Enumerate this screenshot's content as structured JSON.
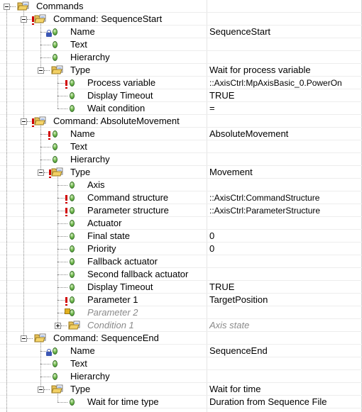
{
  "window": {
    "title": "Commands"
  },
  "rows": [
    {
      "label": "Commands",
      "value": "",
      "level": 0,
      "kind": "folder",
      "expander": "open",
      "icon": "commands-folder-icon"
    },
    {
      "label": "Command: SequenceStart",
      "value": "",
      "level": 1,
      "kind": "folder",
      "expander": "open",
      "error": true,
      "icon": "command-folder-icon"
    },
    {
      "label": "Name",
      "value": "SequenceStart",
      "level": 2,
      "kind": "leaf",
      "lock": true,
      "icon": "property-icon"
    },
    {
      "label": "Text",
      "value": "",
      "level": 2,
      "kind": "leaf",
      "icon": "property-icon"
    },
    {
      "label": "Hierarchy",
      "value": "",
      "level": 2,
      "kind": "leaf",
      "icon": "property-icon"
    },
    {
      "label": "Type",
      "value": "Wait for process variable",
      "level": 2,
      "kind": "folder",
      "expander": "open",
      "icon": "type-folder-icon"
    },
    {
      "label": "Process variable",
      "value": "::AxisCtrl:MpAxisBasic_0.PowerOn",
      "level": 3,
      "kind": "leaf",
      "error": true,
      "small": true,
      "icon": "property-icon"
    },
    {
      "label": "Display Timeout",
      "value": "TRUE",
      "level": 3,
      "kind": "leaf",
      "icon": "property-icon"
    },
    {
      "label": "Wait condition",
      "value": "=",
      "level": 3,
      "kind": "leaf",
      "icon": "property-icon"
    },
    {
      "label": "Command: AbsoluteMovement",
      "value": "",
      "level": 1,
      "kind": "folder",
      "expander": "open",
      "error": true,
      "icon": "command-folder-icon"
    },
    {
      "label": "Name",
      "value": "AbsoluteMovement",
      "level": 2,
      "kind": "leaf",
      "error": true,
      "icon": "property-icon"
    },
    {
      "label": "Text",
      "value": "",
      "level": 2,
      "kind": "leaf",
      "icon": "property-icon"
    },
    {
      "label": "Hierarchy",
      "value": "",
      "level": 2,
      "kind": "leaf",
      "icon": "property-icon"
    },
    {
      "label": "Type",
      "value": "Movement",
      "level": 2,
      "kind": "folder",
      "expander": "open",
      "error": true,
      "icon": "type-folder-icon"
    },
    {
      "label": "Axis",
      "value": "",
      "level": 3,
      "kind": "leaf",
      "icon": "property-icon"
    },
    {
      "label": "Command structure",
      "value": "::AxisCtrl:CommandStructure",
      "level": 3,
      "kind": "leaf",
      "error": true,
      "small": true,
      "icon": "property-icon"
    },
    {
      "label": "Parameter structure",
      "value": "::AxisCtrl:ParameterStructure",
      "level": 3,
      "kind": "leaf",
      "error": true,
      "small": true,
      "icon": "property-icon"
    },
    {
      "label": "Actuator",
      "value": "",
      "level": 3,
      "kind": "leaf",
      "icon": "property-icon"
    },
    {
      "label": "Final state",
      "value": "0",
      "level": 3,
      "kind": "leaf",
      "icon": "property-icon"
    },
    {
      "label": "Priority",
      "value": "0",
      "level": 3,
      "kind": "leaf",
      "icon": "property-icon"
    },
    {
      "label": "Fallback actuator",
      "value": "",
      "level": 3,
      "kind": "leaf",
      "icon": "property-icon"
    },
    {
      "label": "Second fallback actuator",
      "value": "",
      "level": 3,
      "kind": "leaf",
      "icon": "property-icon"
    },
    {
      "label": "Display Timeout",
      "value": "TRUE",
      "level": 3,
      "kind": "leaf",
      "icon": "property-icon"
    },
    {
      "label": "Parameter 1",
      "value": "TargetPosition",
      "level": 3,
      "kind": "leaf",
      "error": true,
      "icon": "property-icon"
    },
    {
      "label": "Parameter 2",
      "value": "",
      "level": 3,
      "kind": "leaf",
      "disabled": true,
      "sel": true,
      "icon": "property-icon"
    },
    {
      "label": "Condition 1",
      "value": "Axis state",
      "level": 3,
      "kind": "folder",
      "expander": "collapsed",
      "disabled": true,
      "icon": "condition-folder-icon"
    },
    {
      "label": "Command: SequenceEnd",
      "value": "",
      "level": 1,
      "kind": "folder",
      "expander": "open",
      "icon": "command-folder-icon"
    },
    {
      "label": "Name",
      "value": "SequenceEnd",
      "level": 2,
      "kind": "leaf",
      "lock": true,
      "icon": "property-icon"
    },
    {
      "label": "Text",
      "value": "",
      "level": 2,
      "kind": "leaf",
      "icon": "property-icon"
    },
    {
      "label": "Hierarchy",
      "value": "",
      "level": 2,
      "kind": "leaf",
      "icon": "property-icon"
    },
    {
      "label": "Type",
      "value": "Wait for time",
      "level": 2,
      "kind": "folder",
      "expander": "open",
      "icon": "type-folder-icon"
    },
    {
      "label": "Wait for time type",
      "value": "Duration from Sequence File",
      "level": 3,
      "kind": "leaf",
      "icon": "property-icon"
    }
  ]
}
